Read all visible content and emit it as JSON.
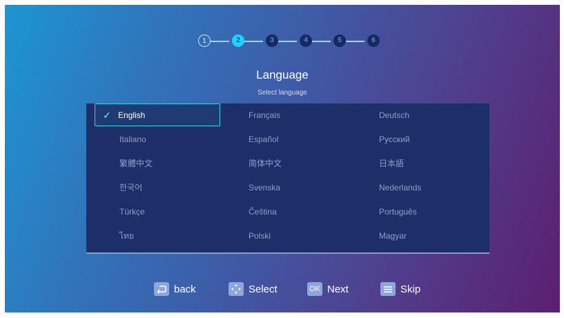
{
  "stepper": {
    "steps": [
      "1",
      "2",
      "3",
      "4",
      "5",
      "6"
    ],
    "current_step": 2
  },
  "header": {
    "title": "Language",
    "subtitle": "Select language"
  },
  "languages": [
    [
      "English",
      "Français",
      "Deutsch"
    ],
    [
      "Italiano",
      "Español",
      "Русский"
    ],
    [
      "繁體中文",
      "简体中文",
      "日本語"
    ],
    [
      "한국어",
      "Svenska",
      "Nederlands"
    ],
    [
      "Türkçe",
      "Čeština",
      "Português"
    ],
    [
      "ไทย",
      "Polski",
      "Magyar"
    ]
  ],
  "selected_language": "English",
  "footer": {
    "back": "back",
    "select": "Select",
    "ok_key": "OK",
    "next": "Next",
    "skip": "Skip"
  },
  "colors": {
    "accent": "#17d7ff",
    "panel": "#1c2f68",
    "unselected_text": "#8f9fca"
  }
}
